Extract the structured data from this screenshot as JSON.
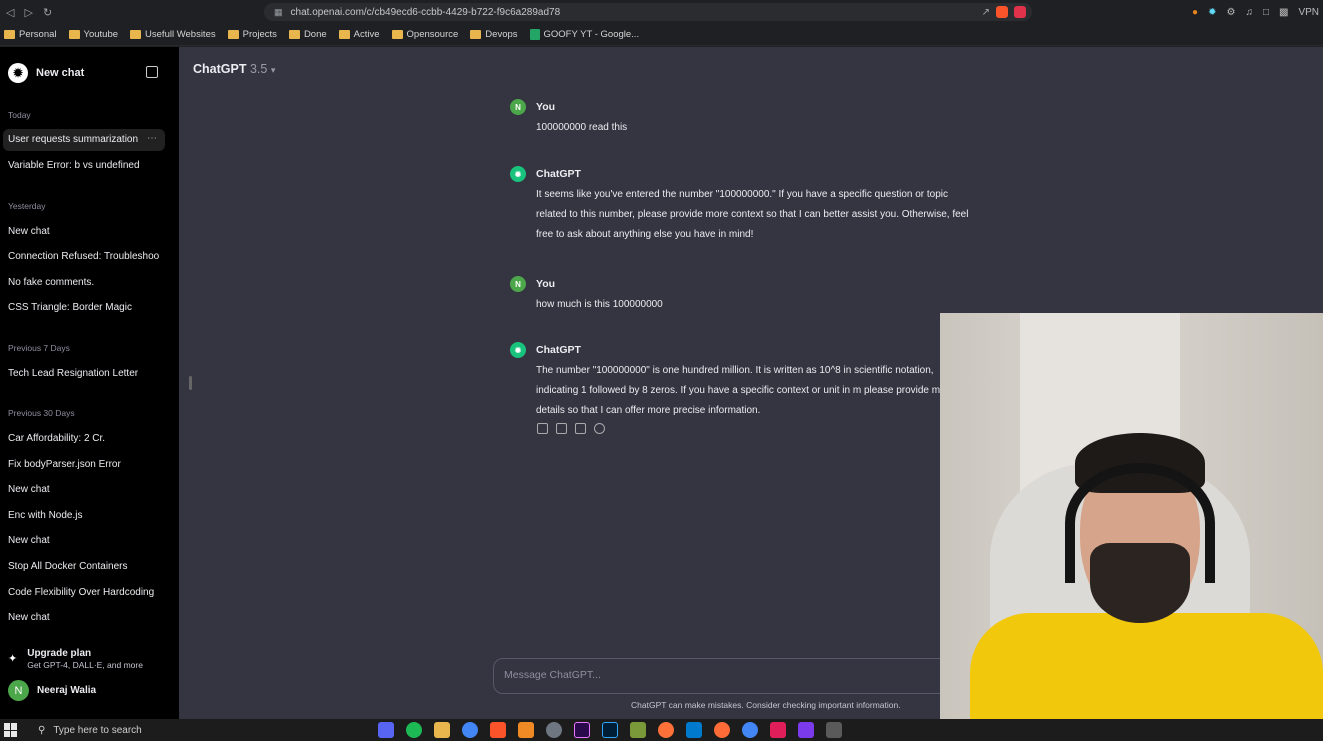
{
  "browser": {
    "url": "chat.openai.com/c/cb49ecd6-ccbb-4429-b722-f9c6a289ad78",
    "extensions_label": "VPN",
    "bookmarks": [
      {
        "label": "Personal",
        "icon": "folder-icon"
      },
      {
        "label": "Youtube",
        "icon": "folder-icon"
      },
      {
        "label": "Usefull Websites",
        "icon": "folder-icon"
      },
      {
        "label": "Projects",
        "icon": "folder-icon"
      },
      {
        "label": "Done",
        "icon": "folder-icon"
      },
      {
        "label": "Active",
        "icon": "folder-icon"
      },
      {
        "label": "Opensource",
        "icon": "folder-icon"
      },
      {
        "label": "Devops",
        "icon": "folder-icon"
      },
      {
        "label": "GOOFY YT - Google...",
        "icon": "sheets-icon"
      }
    ]
  },
  "sidebar": {
    "new_chat": "New chat",
    "sections": [
      {
        "label": "Today",
        "items": [
          "User requests summarization",
          "Variable Error: b vs undefined"
        ]
      },
      {
        "label": "Yesterday",
        "items": [
          "New chat",
          "Connection Refused: Troubleshoo",
          "No fake comments.",
          "CSS Triangle: Border Magic"
        ]
      },
      {
        "label": "Previous 7 Days",
        "items": [
          "Tech Lead Resignation Letter"
        ]
      },
      {
        "label": "Previous 30 Days",
        "items": [
          "Car Affordability: 2 Cr.",
          "Fix bodyParser.json Error",
          "New chat",
          "Enc with Node.js",
          "New chat",
          "Stop All Docker Containers",
          "Code Flexibility Over Hardcoding",
          "New chat"
        ]
      }
    ],
    "upgrade_title": "Upgrade plan",
    "upgrade_subtitle": "Get GPT-4, DALL·E, and more",
    "user_initial": "N",
    "user_name": "Neeraj Walia"
  },
  "main": {
    "model_name": "ChatGPT",
    "model_version": "3.5",
    "messages": [
      {
        "author": "You",
        "text": "100000000 read this"
      },
      {
        "author": "ChatGPT",
        "text": "It seems like you've entered the number \"100000000.\" If you have a specific question or topic related to this number, please provide more context so that I can better assist you. Otherwise, feel free to ask about anything else you have in mind!"
      },
      {
        "author": "You",
        "text": "how much is this 100000000"
      },
      {
        "author": "ChatGPT",
        "text": "The number \"100000000\" is one hundred million. It is written as 10^8 in scientific notation, indicating 1 followed by 8 zeros. If you have a specific context or unit in m please provide more details so that I can offer more precise information."
      }
    ],
    "input_placeholder": "Message ChatGPT...",
    "disclaimer": "ChatGPT can make mistakes. Consider checking important information."
  },
  "taskbar": {
    "search_placeholder": "Type here to search"
  },
  "colors": {
    "sidebar_bg": "#000000",
    "main_bg": "#343541",
    "user_avatar": "#4ca64a",
    "gpt_avatar": "#19c37d"
  }
}
